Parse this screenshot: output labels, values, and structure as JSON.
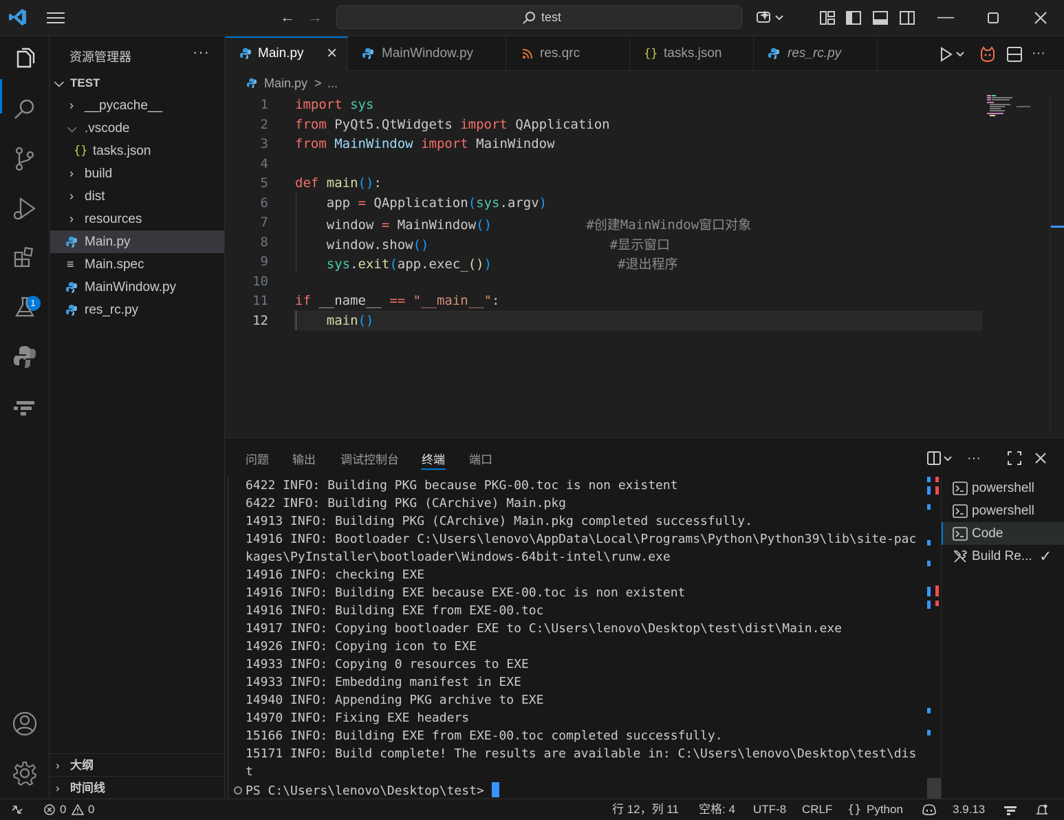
{
  "search": {
    "text": "test"
  },
  "sidebar": {
    "title": "资源管理器",
    "root": "TEST",
    "items": [
      {
        "label": "__pycache__"
      },
      {
        "label": ".vscode"
      },
      {
        "label": "tasks.json"
      },
      {
        "label": "build"
      },
      {
        "label": "dist"
      },
      {
        "label": "resources"
      },
      {
        "label": "Main.py"
      },
      {
        "label": "Main.spec"
      },
      {
        "label": "MainWindow.py"
      },
      {
        "label": "res_rc.py"
      }
    ],
    "outline": "大纲",
    "timeline": "时间线",
    "extensions_badge": "1"
  },
  "tabs": [
    {
      "label": "Main.py"
    },
    {
      "label": "MainWindow.py"
    },
    {
      "label": "res.qrc"
    },
    {
      "label": "tasks.json"
    },
    {
      "label": "res_rc.py"
    }
  ],
  "breadcrumb": {
    "file": "Main.py",
    "sep": ">",
    "more": "..."
  },
  "editor": {
    "line_numbers": [
      "1",
      "2",
      "3",
      "4",
      "5",
      "6",
      "7",
      "8",
      "9",
      "10",
      "11",
      "12"
    ],
    "comments": [
      "#创建MainWindow窗口对象",
      "#显示窗口",
      "#退出程序"
    ]
  },
  "panel": {
    "tabs": [
      "问题",
      "输出",
      "调试控制台",
      "终端",
      "端口"
    ],
    "terminal_lines": [
      "6422 INFO: Building PKG because PKG-00.toc is non existent",
      "6422 INFO: Building PKG (CArchive) Main.pkg",
      "14913 INFO: Building PKG (CArchive) Main.pkg completed successfully.",
      "14916 INFO: Bootloader C:\\Users\\lenovo\\AppData\\Local\\Programs\\Python\\Python39\\lib\\site-pac",
      "kages\\PyInstaller\\bootloader\\Windows-64bit-intel\\runw.exe",
      "14916 INFO: checking EXE",
      "14916 INFO: Building EXE because EXE-00.toc is non existent",
      "14916 INFO: Building EXE from EXE-00.toc",
      "14917 INFO: Copying bootloader EXE to C:\\Users\\lenovo\\Desktop\\test\\dist\\Main.exe",
      "14926 INFO: Copying icon to EXE",
      "14933 INFO: Copying 0 resources to EXE",
      "14933 INFO: Embedding manifest in EXE",
      "14940 INFO: Appending PKG archive to EXE",
      "14970 INFO: Fixing EXE headers",
      "15166 INFO: Building EXE from EXE-00.toc completed successfully.",
      "15171 INFO: Build complete! The results are available in: C:\\Users\\lenovo\\Desktop\\test\\dis",
      "t"
    ],
    "prompt": "PS C:\\Users\\lenovo\\Desktop\\test> ",
    "terminals": [
      {
        "label": "powershell"
      },
      {
        "label": "powershell"
      },
      {
        "label": "Code"
      },
      {
        "label": "Build Re..."
      }
    ]
  },
  "statusbar": {
    "errors": "0",
    "warnings": "0",
    "position": "行 12，列 11",
    "spaces": "空格: 4",
    "encoding": "UTF-8",
    "eol": "CRLF",
    "language": "Python",
    "python_version": "3.9.13"
  },
  "colors": {
    "accent": "#0078d4",
    "keyword": "#c586c0",
    "function": "#dcdcaa",
    "class": "#4ec9b0"
  }
}
